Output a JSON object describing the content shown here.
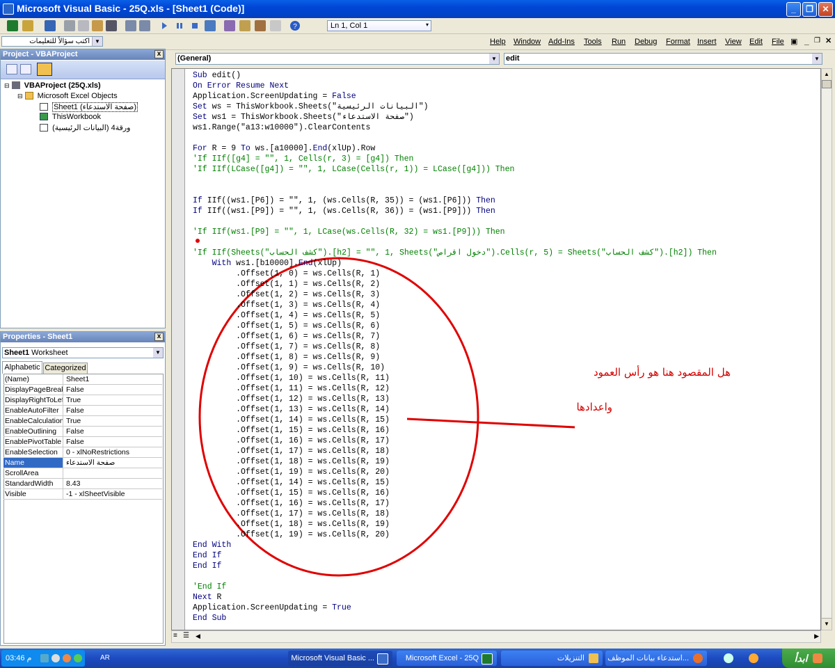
{
  "window": {
    "title": "Microsoft Visual Basic - 25Q.xls - [Sheet1 (Code)]"
  },
  "toolbar": {
    "position": "Ln 1, Col 1"
  },
  "menubar": {
    "question_placeholder": "اكتب سؤالاً للتعليمات",
    "items": [
      "Help",
      "Window",
      "Add-Ins",
      "Tools",
      "Run",
      "Debug",
      "Format",
      "Insert",
      "View",
      "Edit",
      "File"
    ]
  },
  "project": {
    "title": "Project - VBAProject",
    "root": "VBAProject (25Q.xls)",
    "folder": "Microsoft Excel Objects",
    "items": [
      "Sheet1 (صفحة الاستدعاء)",
      "ThisWorkbook",
      "ورقة4 (البيانات الرئيسية)"
    ]
  },
  "properties": {
    "title": "Properties - Sheet1",
    "object_name": "Sheet1",
    "object_type": "Worksheet",
    "tabs": [
      "Alphabetic",
      "Categorized"
    ],
    "rows": [
      {
        "name": "(Name)",
        "value": "Sheet1"
      },
      {
        "name": "DisplayPageBreaks",
        "value": "False"
      },
      {
        "name": "DisplayRightToLeft",
        "value": "True"
      },
      {
        "name": "EnableAutoFilter",
        "value": "False"
      },
      {
        "name": "EnableCalculation",
        "value": "True"
      },
      {
        "name": "EnableOutlining",
        "value": "False"
      },
      {
        "name": "EnablePivotTable",
        "value": "False"
      },
      {
        "name": "EnableSelection",
        "value": "0 - xlNoRestrictions"
      },
      {
        "name": "Name",
        "value": "صفحة الاستدعاء"
      },
      {
        "name": "ScrollArea",
        "value": ""
      },
      {
        "name": "StandardWidth",
        "value": "8.43"
      },
      {
        "name": "Visible",
        "value": "-1 - xlSheetVisible"
      }
    ]
  },
  "code": {
    "object_combo": "(General)",
    "procedure_combo": "edit",
    "lines": [
      "Sub edit()",
      "On Error Resume Next",
      "Application.ScreenUpdating = False",
      "Set ws = ThisWorkbook.Sheets(\"البيانات الرئيسية\")",
      "Set ws1 = ThisWorkbook.Sheets(\"صفحة الاستدعاء\")",
      "ws1.Range(\"a13:w10000\").ClearContents",
      "",
      "For R = 9 To ws.[a10000].End(xlUp).Row",
      "'If IIf([g4] = \"\", 1, Cells(r, 3) = [g4]) Then",
      "'If IIf(LCase([g4]) = \"\", 1, LCase(Cells(r, 1)) = LCase([g4])) Then",
      "",
      "",
      "If IIf((ws1.[P6]) = \"\", 1, (ws.Cells(R, 35)) = (ws1.[P6])) Then",
      "If IIf((ws1.[P9]) = \"\", 1, (ws.Cells(R, 36)) = (ws1.[P9])) Then",
      "",
      "'If IIf(ws1.[P9] = \"\", 1, LCase(ws.Cells(R, 32) = ws1.[P9])) Then",
      "",
      "'If IIf(Sheets(\"كشف الحساب\").[h2] = \"\", 1, Sheets(\"دخول اقراص\").Cells(r, 5) = Sheets(\"كشف الحساب\").[h2]) Then",
      "    With ws1.[b10000].End(xlUp)",
      "         .Offset(1, 0) = ws.Cells(R, 1)",
      "         .Offset(1, 1) = ws.Cells(R, 2)",
      "         .Offset(1, 2) = ws.Cells(R, 3)",
      "         .Offset(1, 3) = ws.Cells(R, 4)",
      "         .Offset(1, 4) = ws.Cells(R, 5)",
      "         .Offset(1, 5) = ws.Cells(R, 6)",
      "         .Offset(1, 6) = ws.Cells(R, 7)",
      "         .Offset(1, 7) = ws.Cells(R, 8)",
      "         .Offset(1, 8) = ws.Cells(R, 9)",
      "         .Offset(1, 9) = ws.Cells(R, 10)",
      "         .Offset(1, 10) = ws.Cells(R, 11)",
      "         .Offset(1, 11) = ws.Cells(R, 12)",
      "         .Offset(1, 12) = ws.Cells(R, 13)",
      "         .Offset(1, 13) = ws.Cells(R, 14)",
      "         .Offset(1, 14) = ws.Cells(R, 15)",
      "         .Offset(1, 15) = ws.Cells(R, 16)",
      "         .Offset(1, 16) = ws.Cells(R, 17)",
      "         .Offset(1, 17) = ws.Cells(R, 18)",
      "         .Offset(1, 18) = ws.Cells(R, 19)",
      "         .Offset(1, 19) = ws.Cells(R, 20)",
      "         .Offset(1, 14) = ws.Cells(R, 15)",
      "         .Offset(1, 15) = ws.Cells(R, 16)",
      "         .Offset(1, 16) = ws.Cells(R, 17)",
      "         .Offset(1, 17) = ws.Cells(R, 18)",
      "         .Offset(1, 18) = ws.Cells(R, 19)",
      "         .Offset(1, 19) = ws.Cells(R, 20)",
      "End With",
      "End If",
      "End If",
      "",
      "'End If",
      "Next R",
      "Application.ScreenUpdating = True",
      "End Sub"
    ]
  },
  "annotation": {
    "line1": "هل المقصود هنا هو رأس العمود",
    "line2": "واعدادها"
  },
  "taskbar": {
    "start": "ابدأ",
    "buttons": [
      "استدعاء بيانات الموظف...",
      "التنزيلات",
      "Microsoft Excel - 25Q",
      "Microsoft Visual Basic ..."
    ],
    "lang": "AR",
    "clock": "03:46 م"
  },
  "colors": {
    "keyword": "#00007F",
    "comment": "#008000",
    "annotation": "#D40000"
  }
}
